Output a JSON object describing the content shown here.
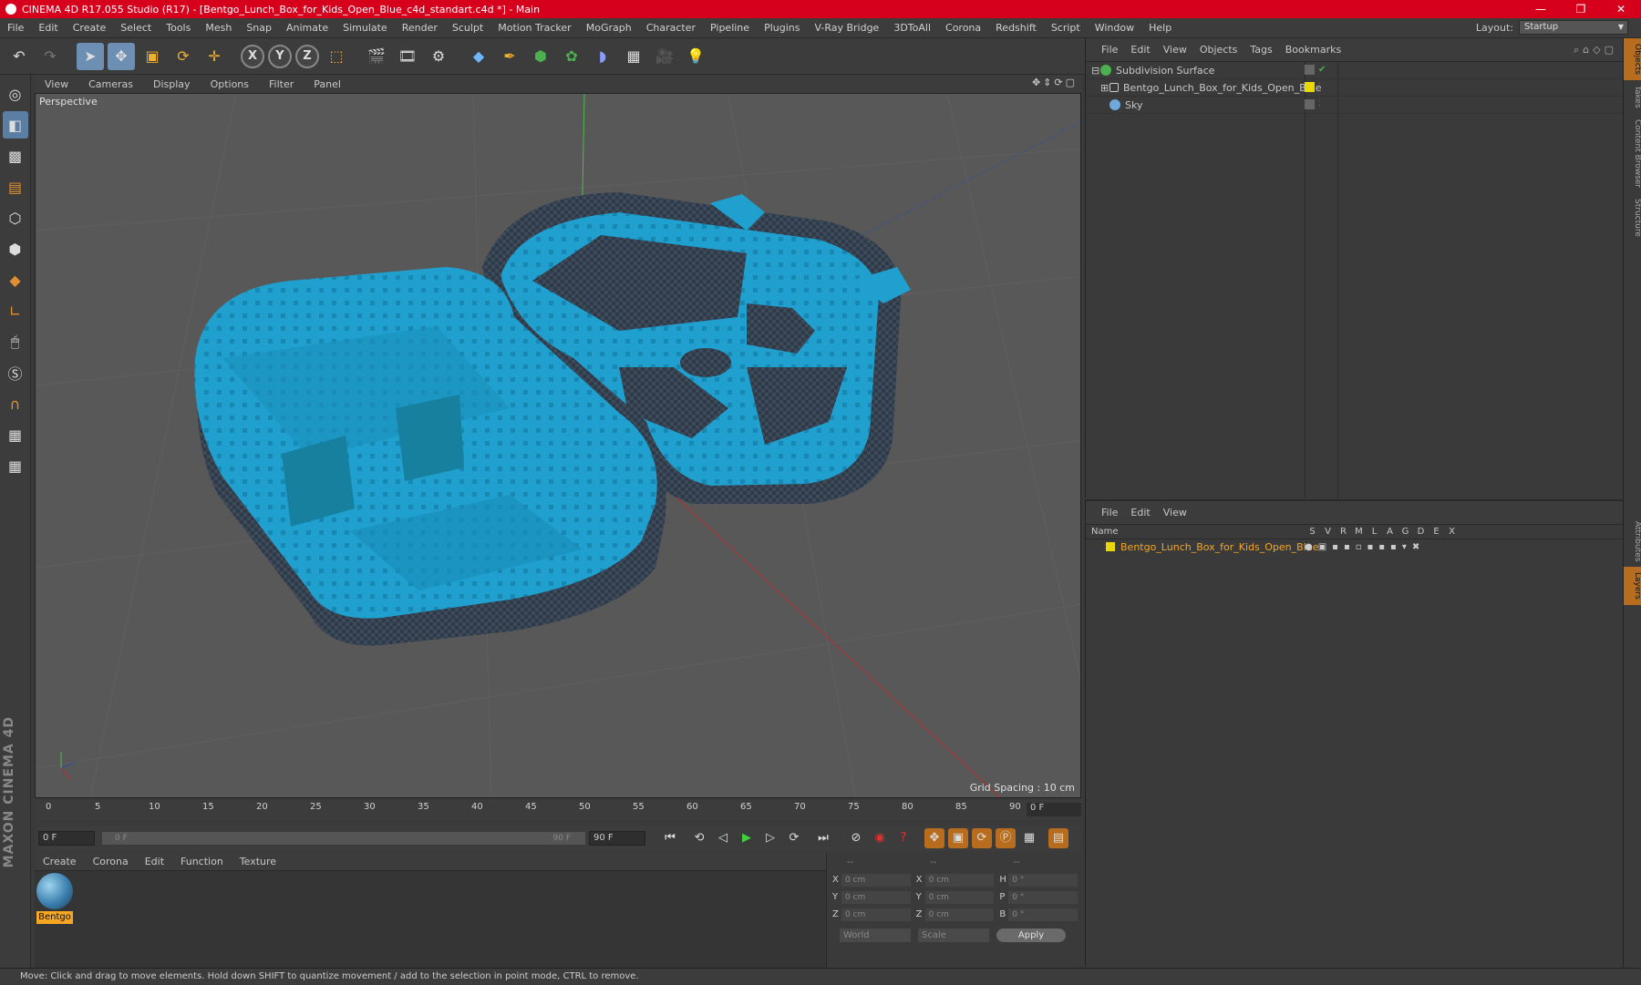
{
  "titlebar": {
    "title": "CINEMA 4D R17.055 Studio (R17) - [Bentgo_Lunch_Box_for_Kids_Open_Blue_c4d_standart.c4d *] - Main"
  },
  "menu": [
    "File",
    "Edit",
    "Create",
    "Select",
    "Tools",
    "Mesh",
    "Snap",
    "Animate",
    "Simulate",
    "Render",
    "Sculpt",
    "Motion Tracker",
    "MoGraph",
    "Character",
    "Pipeline",
    "Plugins",
    "V-Ray Bridge",
    "3DToAll",
    "Corona",
    "Redshift",
    "Script",
    "Window",
    "Help"
  ],
  "layout": {
    "label": "Layout:",
    "value": "Startup"
  },
  "viewport_menu": [
    "View",
    "Cameras",
    "Display",
    "Options",
    "Filter",
    "Panel"
  ],
  "viewport": {
    "label": "Perspective",
    "grid_spacing": "Grid Spacing : 10 cm"
  },
  "timeline": {
    "ticks": [
      "0",
      "5",
      "10",
      "15",
      "20",
      "25",
      "30",
      "35",
      "40",
      "45",
      "50",
      "55",
      "60",
      "65",
      "70",
      "75",
      "80",
      "85",
      "90"
    ],
    "end_frame": "0 F"
  },
  "transport": {
    "start": "0 F",
    "slider_start": "0 F",
    "slider_end": "90 F",
    "end": "90 F"
  },
  "material_menu": [
    "Create",
    "Corona",
    "Edit",
    "Function",
    "Texture"
  ],
  "material": {
    "name": "Bentgo"
  },
  "coords": {
    "headers": [
      "--",
      "--",
      "--"
    ],
    "rows": [
      {
        "a": "X",
        "v1": "0 cm",
        "b": "X",
        "v2": "0 cm",
        "c": "H",
        "v3": "0 °"
      },
      {
        "a": "Y",
        "v1": "0 cm",
        "b": "Y",
        "v2": "0 cm",
        "c": "P",
        "v3": "0 °"
      },
      {
        "a": "Z",
        "v1": "0 cm",
        "b": "Z",
        "v2": "0 cm",
        "c": "B",
        "v3": "0 °"
      }
    ],
    "world": "World",
    "scale": "Scale",
    "apply": "Apply"
  },
  "object_menu": [
    "File",
    "Edit",
    "View",
    "Objects",
    "Tags",
    "Bookmarks"
  ],
  "objects": [
    {
      "name": "Subdivision Surface",
      "color": "#4caf50"
    },
    {
      "name": "Bentgo_Lunch_Box_for_Kids_Open_Blue",
      "color": "#e0e0e0"
    },
    {
      "name": "Sky",
      "color": "#6fa8dc"
    }
  ],
  "layer_menu": [
    "File",
    "Edit",
    "View"
  ],
  "layer_header": {
    "name": "Name",
    "cols": [
      "S",
      "V",
      "R",
      "M",
      "L",
      "A",
      "G",
      "D",
      "E",
      "X"
    ]
  },
  "layer": {
    "name": "Bentgo_Lunch_Box_for_Kids_Open_Blue"
  },
  "right_tabs": [
    "Objects",
    "Takes",
    "Content Browser",
    "Structure",
    "Attributes",
    "Layers"
  ],
  "status": "Move: Click and drag to move elements. Hold down SHIFT to quantize movement / add to the selection in point mode, CTRL to remove.",
  "branding": "MAXON CINEMA 4D"
}
